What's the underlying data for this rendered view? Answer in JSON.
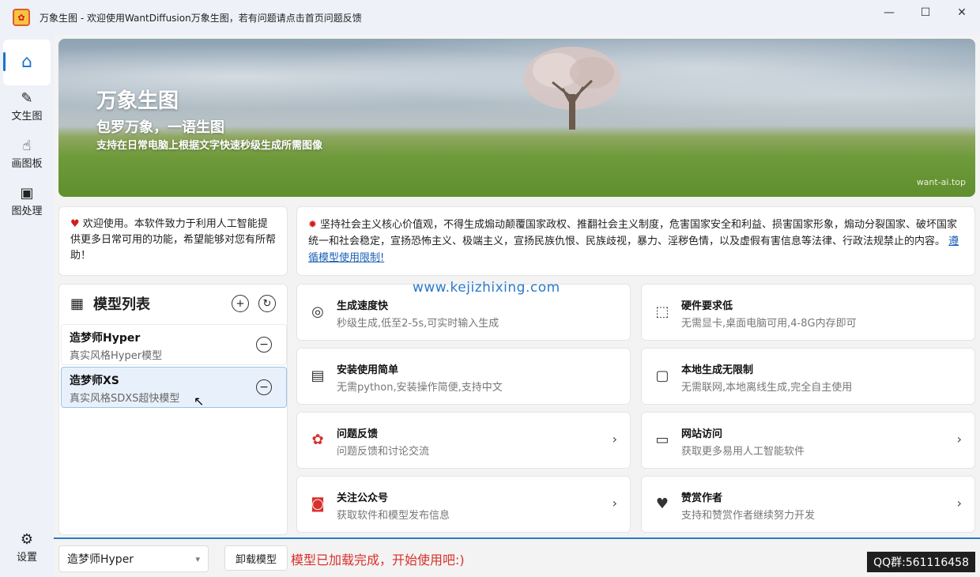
{
  "window": {
    "title": "万象生图 - 欢迎使用WantDiffusion万象生图，若有问题请点击首页问题反馈",
    "controls": {
      "minimize": "—",
      "maximize": "☐",
      "close": "✕"
    }
  },
  "sidebar": {
    "items": [
      {
        "label": "",
        "icon": "home-icon",
        "glyph": "⌂"
      },
      {
        "label": "文生图",
        "icon": "text-to-image-icon",
        "glyph": "✎"
      },
      {
        "label": "画图板",
        "icon": "drawing-board-icon",
        "glyph": "☝"
      },
      {
        "label": "图处理",
        "icon": "image-process-icon",
        "glyph": "▣"
      }
    ],
    "settings": {
      "label": "设置",
      "icon": "gear-icon",
      "glyph": "⚙"
    }
  },
  "banner": {
    "title": "万象生图",
    "subtitle": "包罗万象，一语生图",
    "description": "支持在日常电脑上根据文字快速秒级生成所需图像",
    "watermark": "want-ai.top"
  },
  "welcome": {
    "text": "欢迎使用。本软件致力于利用人工智能提供更多日常可用的功能，希望能够对您有所帮助！"
  },
  "notice": {
    "text": "坚持社会主义核心价值观，不得生成煽动颠覆国家政权、推翻社会主义制度，危害国家安全和利益、损害国家形象，煽动分裂国家、破坏国家统一和社会稳定，宣扬恐怖主义、极端主义，宣扬民族仇恨、民族歧视，暴力、淫秽色情，以及虚假有害信息等法律、行政法规禁止的内容。",
    "link": "遵循模型使用限制!"
  },
  "model_list": {
    "title": "模型列表",
    "models": [
      {
        "name": "造梦师Hyper",
        "desc": "真实风格Hyper模型",
        "selected": false
      },
      {
        "name": "造梦师XS",
        "desc": "真实风格SDXS超快模型",
        "selected": true
      }
    ]
  },
  "features": [
    {
      "title": "生成速度快",
      "desc": "秒级生成,低至2-5s,可实时输入生成",
      "icon": "speed-icon",
      "glyph": "◎",
      "chevron": false
    },
    {
      "title": "硬件要求低",
      "desc": "无需显卡,桌面电脑可用,4-8G内存即可",
      "icon": "chip-icon",
      "glyph": "⬚",
      "chevron": false
    },
    {
      "title": "安装使用简单",
      "desc": "无需python,安装操作简便,支持中文",
      "icon": "install-icon",
      "glyph": "▤",
      "chevron": false
    },
    {
      "title": "本地生成无限制",
      "desc": "无需联网,本地离线生成,完全自主使用",
      "icon": "local-icon",
      "glyph": "▢",
      "chevron": false
    },
    {
      "title": "问题反馈",
      "desc": "问题反馈和讨论交流",
      "icon": "feedback-icon",
      "glyph": "✿",
      "chevron": true,
      "red": true
    },
    {
      "title": "网站访问",
      "desc": "获取更多易用人工智能软件",
      "icon": "website-icon",
      "glyph": "▭",
      "chevron": true
    },
    {
      "title": "关注公众号",
      "desc": "获取软件和模型发布信息",
      "icon": "wechat-icon",
      "glyph": "◙",
      "chevron": true,
      "red": true
    },
    {
      "title": "赞赏作者",
      "desc": "支持和赞赏作者继续努力开发",
      "icon": "donate-icon",
      "glyph": "♥",
      "chevron": true
    }
  ],
  "site_watermark": "www.kejizhixing.com",
  "bottom": {
    "model_select": "造梦师Hyper",
    "unload_button": "卸载模型",
    "status": "模型已加载完成，开始使用吧:)",
    "qq": "QQ群:561116458"
  }
}
